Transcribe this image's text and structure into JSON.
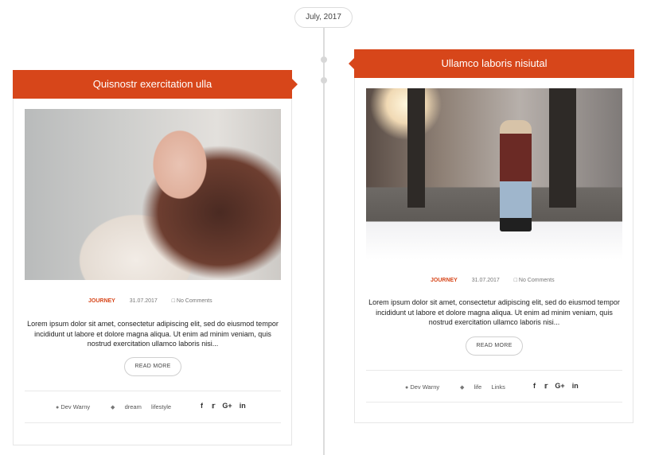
{
  "timeline": {
    "date": "July, 2017"
  },
  "posts": [
    {
      "title": "Quisnostr exercitation ulla",
      "category": "JOURNEY",
      "date": "31.07.2017",
      "comments": "No Comments",
      "excerpt": "Lorem ipsum dolor sit amet, consectetur adipiscing elit, sed do eiusmod tempor incididunt ut labore et dolore magna aliqua. Ut enim ad minim veniam, quis nostrud exercitation ullamco laboris nisi...",
      "read_more": "READ MORE",
      "author": "Dev Warny",
      "tags": [
        "dream",
        "lifestyle"
      ]
    },
    {
      "title": "Ullamco laboris nisiutal",
      "category": "JOURNEY",
      "date": "31.07.2017",
      "comments": "No Comments",
      "excerpt": "Lorem ipsum dolor sit amet, consectetur adipiscing elit, sed do eiusmod tempor incididunt ut labore et dolore magna aliqua. Ut enim ad minim veniam, quis nostrud exercitation ullamco laboris nisi...",
      "read_more": "READ MORE",
      "author": "Dev Warny",
      "tags": [
        "life",
        "Links"
      ]
    }
  ],
  "social_icons": [
    "f",
    "t",
    "G+",
    "in"
  ],
  "icons": {
    "author": "user-icon",
    "tags": "tag-icon",
    "comments": "comment-icon"
  },
  "colors": {
    "accent": "#d7461a",
    "line": "#dcdcdc"
  }
}
